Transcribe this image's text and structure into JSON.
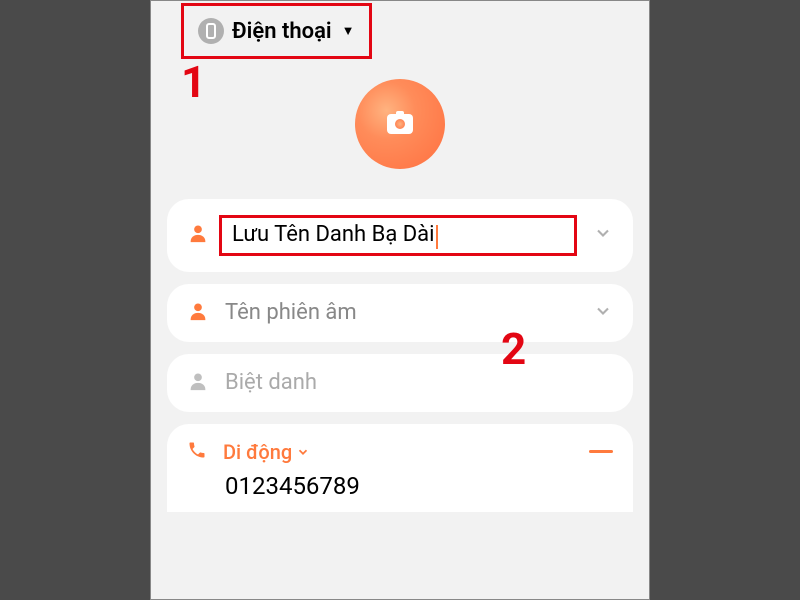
{
  "storage": {
    "label": "Điện thoại"
  },
  "annotations": {
    "one": "1",
    "two": "2"
  },
  "fields": {
    "name": {
      "value": "Lưu Tên Danh Bạ Dài"
    },
    "phonetic": {
      "placeholder": "Tên phiên âm"
    },
    "nickname": {
      "placeholder": "Biệt danh"
    }
  },
  "phone": {
    "type_label": "Di động",
    "number": "0123456789"
  }
}
